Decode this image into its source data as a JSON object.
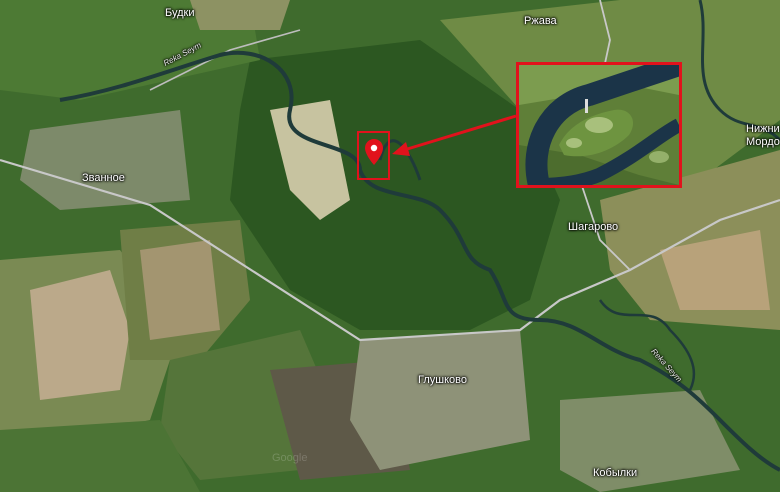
{
  "map": {
    "place_labels": [
      {
        "id": "budki",
        "text": "Будки"
      },
      {
        "id": "rzhava",
        "text": "Ржава"
      },
      {
        "id": "zvannoe",
        "text": "Званное"
      },
      {
        "id": "shagarovo",
        "text": "Шагарово"
      },
      {
        "id": "glushkovo",
        "text": "Глушково"
      },
      {
        "id": "kobylki",
        "text": "Кобылки"
      },
      {
        "id": "nizhnie",
        "text": "Нижни"
      },
      {
        "id": "mordo",
        "text": "Мордо"
      }
    ],
    "river_labels": [
      {
        "id": "seym-west",
        "text": "Reka Seym"
      },
      {
        "id": "seym-east",
        "text": "Reka Seym"
      }
    ],
    "watermark": "Google",
    "colors": {
      "highlight": "#e1121c",
      "river": "#1f3b3a",
      "forest": "#2d5a22",
      "field": "#7a8f4a",
      "road": "#c8c8c8"
    },
    "marker_icon": "location-pin-icon",
    "callout_arrow_icon": "arrow-left-icon"
  }
}
